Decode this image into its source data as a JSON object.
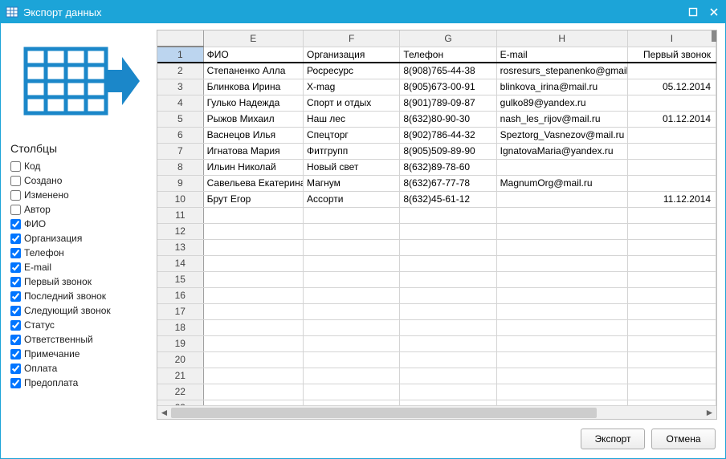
{
  "window": {
    "title": "Экспорт данных"
  },
  "sidebar": {
    "section_title": "Столбцы",
    "items": [
      {
        "label": "Код",
        "checked": false
      },
      {
        "label": "Создано",
        "checked": false
      },
      {
        "label": "Изменено",
        "checked": false
      },
      {
        "label": "Автор",
        "checked": false
      },
      {
        "label": "ФИО",
        "checked": true
      },
      {
        "label": "Организация",
        "checked": true
      },
      {
        "label": "Телефон",
        "checked": true
      },
      {
        "label": "E-mail",
        "checked": true
      },
      {
        "label": "Первый звонок",
        "checked": true
      },
      {
        "label": "Последний звонок",
        "checked": true
      },
      {
        "label": "Следующий звонок",
        "checked": true
      },
      {
        "label": "Статус",
        "checked": true
      },
      {
        "label": "Ответственный",
        "checked": true
      },
      {
        "label": "Примечание",
        "checked": true
      },
      {
        "label": "Оплата",
        "checked": true
      },
      {
        "label": "Предоплата",
        "checked": true
      }
    ]
  },
  "grid": {
    "col_letters": [
      "E",
      "F",
      "G",
      "H",
      "I"
    ],
    "header": {
      "E": "ФИО",
      "F": "Организация",
      "G": "Телефон",
      "H": "E-mail",
      "I": "Первый звонок"
    },
    "rows": [
      {
        "E": "Степаненко Алла",
        "F": "Росресурс",
        "G": "8(908)765-44-38",
        "H": "rosresurs_stepanenko@gmail.com",
        "I": ""
      },
      {
        "E": "Блинкова Ирина",
        "F": "X-mag",
        "G": "8(905)673-00-91",
        "H": "blinkova_irina@mail.ru",
        "I": "05.12.2014"
      },
      {
        "E": "Гулько Надежда",
        "F": "Спорт и отдых",
        "G": "8(901)789-09-87",
        "H": "gulko89@yandex.ru",
        "I": ""
      },
      {
        "E": "Рыжов Михаил",
        "F": "Наш лес",
        "G": "8(632)80-90-30",
        "H": "nash_les_rijov@mail.ru",
        "I": "01.12.2014"
      },
      {
        "E": "Васнецов Илья",
        "F": "Спецторг",
        "G": "8(902)786-44-32",
        "H": "Speztorg_Vasnezov@mail.ru",
        "I": ""
      },
      {
        "E": "Игнатова Мария",
        "F": "Фитгрупп",
        "G": "8(905)509-89-90",
        "H": "IgnatovaMaria@yandex.ru",
        "I": ""
      },
      {
        "E": "Ильин Николай",
        "F": "Новый свет",
        "G": "8(632)89-78-60",
        "H": "",
        "I": ""
      },
      {
        "E": "Савельева Екатерина",
        "F": "Магнум",
        "G": "8(632)67-77-78",
        "H": "MagnumOrg@mail.ru",
        "I": ""
      },
      {
        "E": "Брут Егор",
        "F": "Ассорти",
        "G": "8(632)45-61-12",
        "H": "",
        "I": "11.12.2014"
      }
    ],
    "empty_row_count": 13,
    "selected_row": 1
  },
  "footer": {
    "export_label": "Экспорт",
    "cancel_label": "Отмена"
  }
}
